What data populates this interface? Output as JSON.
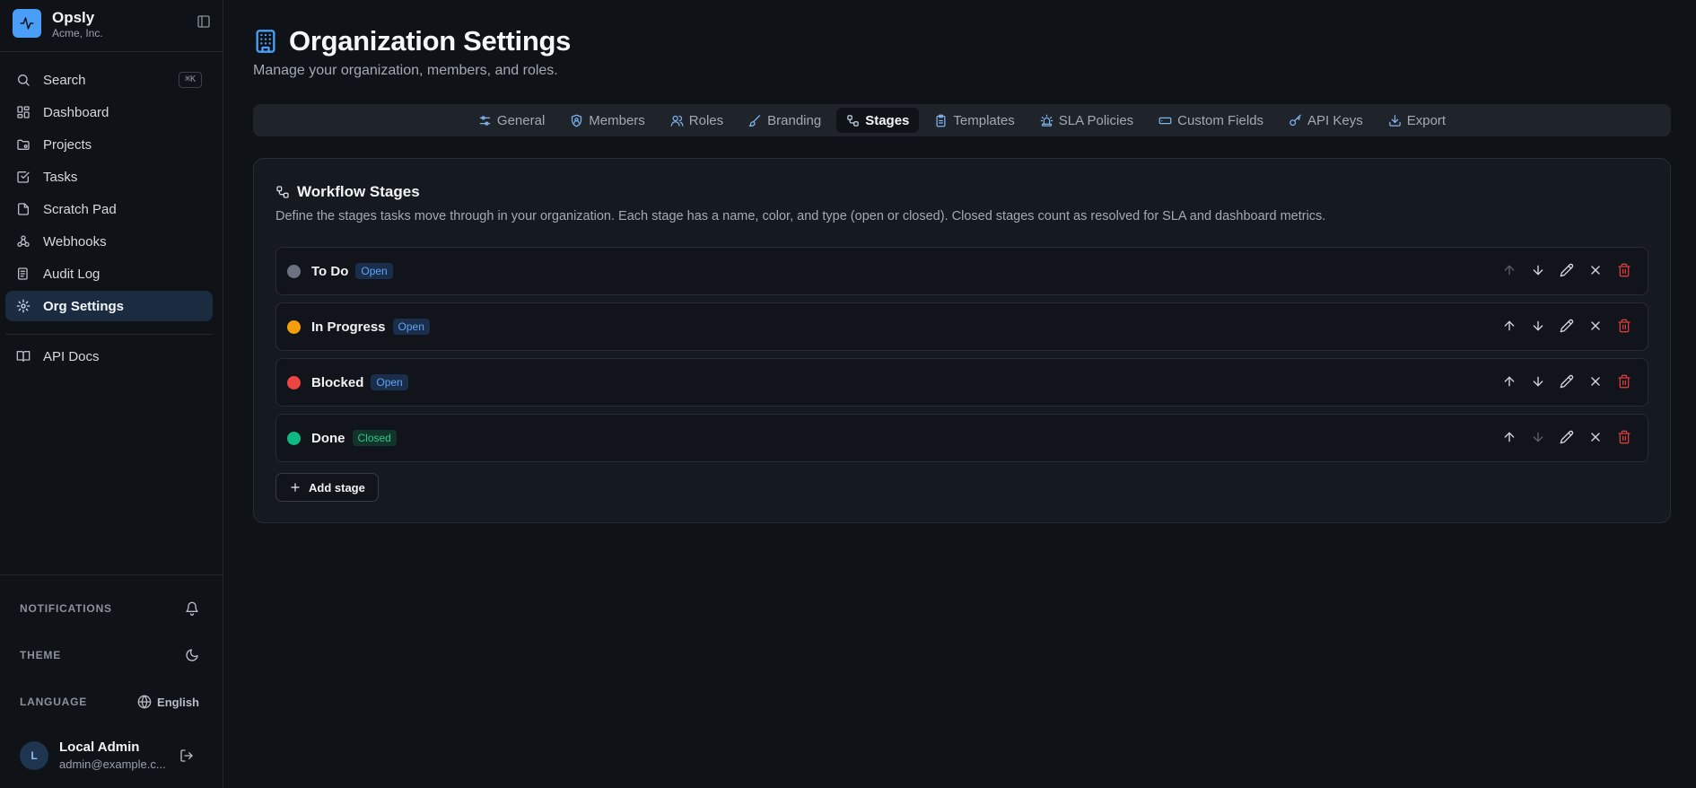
{
  "app": {
    "name": "Opsly",
    "org": "Acme, Inc."
  },
  "sidebar": {
    "items": [
      {
        "label": "Search",
        "icon": "search-icon",
        "shortcut": "⌘K"
      },
      {
        "label": "Dashboard",
        "icon": "dashboard-icon"
      },
      {
        "label": "Projects",
        "icon": "projects-icon"
      },
      {
        "label": "Tasks",
        "icon": "tasks-icon"
      },
      {
        "label": "Scratch Pad",
        "icon": "scratch-pad-icon"
      },
      {
        "label": "Webhooks",
        "icon": "webhooks-icon"
      },
      {
        "label": "Audit Log",
        "icon": "audit-log-icon"
      },
      {
        "label": "Org Settings",
        "icon": "gear-icon",
        "active": true
      },
      {
        "label": "API Docs",
        "icon": "book-icon"
      }
    ],
    "notifications_label": "NOTIFICATIONS",
    "theme_label": "THEME",
    "language_label": "LANGUAGE",
    "language_value": "English",
    "user": {
      "initial": "L",
      "name": "Local Admin",
      "email": "admin@example.c..."
    }
  },
  "page": {
    "title": "Organization Settings",
    "subtitle": "Manage your organization, members, and roles."
  },
  "tabs": [
    {
      "label": "General",
      "icon": "sliders-icon"
    },
    {
      "label": "Members",
      "icon": "shield-user-icon"
    },
    {
      "label": "Roles",
      "icon": "users-icon"
    },
    {
      "label": "Branding",
      "icon": "brush-icon"
    },
    {
      "label": "Stages",
      "icon": "workflow-icon",
      "active": true
    },
    {
      "label": "Templates",
      "icon": "clipboard-icon"
    },
    {
      "label": "SLA Policies",
      "icon": "siren-icon"
    },
    {
      "label": "Custom Fields",
      "icon": "input-field-icon"
    },
    {
      "label": "API Keys",
      "icon": "key-icon"
    },
    {
      "label": "Export",
      "icon": "download-icon"
    }
  ],
  "workflow": {
    "title": "Workflow Stages",
    "description": "Define the stages tasks move through in your organization. Each stage has a name, color, and type (open or closed). Closed stages count as resolved for SLA and dashboard metrics.",
    "add_label": "Add stage",
    "stages": [
      {
        "name": "To Do",
        "type": "Open",
        "color": "#6b7280"
      },
      {
        "name": "In Progress",
        "type": "Open",
        "color": "#f59e0b"
      },
      {
        "name": "Blocked",
        "type": "Open",
        "color": "#ef4444"
      },
      {
        "name": "Done",
        "type": "Closed",
        "color": "#10b981"
      }
    ]
  },
  "colors": {
    "accent": "#4b9ef8",
    "danger": "#d63c3c",
    "open_badge": "#5ea4f5",
    "closed_badge": "#34c38f"
  }
}
